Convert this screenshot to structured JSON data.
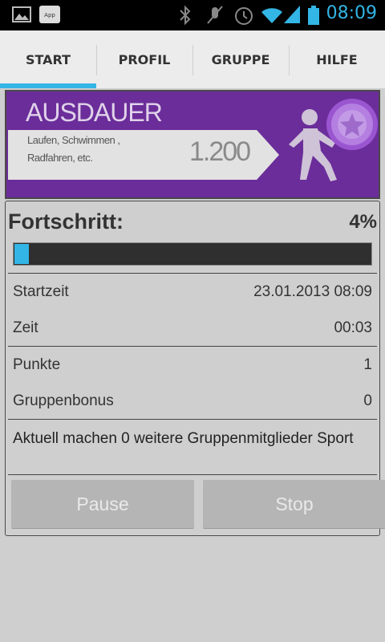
{
  "status_bar": {
    "time": "08:09",
    "icons": [
      "gallery-icon",
      "app-notification-icon",
      "bluetooth-icon",
      "mute-icon",
      "alarm-icon",
      "wifi-icon",
      "signal-icon",
      "battery-icon"
    ]
  },
  "tabs": [
    {
      "label": "START",
      "active": true
    },
    {
      "label": "PROFIL",
      "active": false
    },
    {
      "label": "GRUPPE",
      "active": false
    },
    {
      "label": "HILFE",
      "active": false
    }
  ],
  "banner": {
    "title": "AUSDAUER",
    "subtitle_line1": "Laufen, Schwimmen ,",
    "subtitle_line2": "Radfahren, etc.",
    "value": "1.200",
    "colors": {
      "background": "#6b2d9a",
      "badge": "#b47fe0"
    }
  },
  "progress": {
    "label": "Fortschritt:",
    "percent_text": "4%",
    "value_percent": 4
  },
  "details": {
    "start_label": "Startzeit",
    "start_value": "23.01.2013 08:09",
    "time_label": "Zeit",
    "time_value": "00:03",
    "points_label": "Punkte",
    "points_value": "1",
    "bonus_label": "Gruppenbonus",
    "bonus_value": "0"
  },
  "info_text": "Aktuell machen 0 weitere Gruppenmitglieder Sport",
  "buttons": {
    "pause": "Pause",
    "stop": "Stop"
  },
  "colors": {
    "accent": "#33b5e5"
  }
}
